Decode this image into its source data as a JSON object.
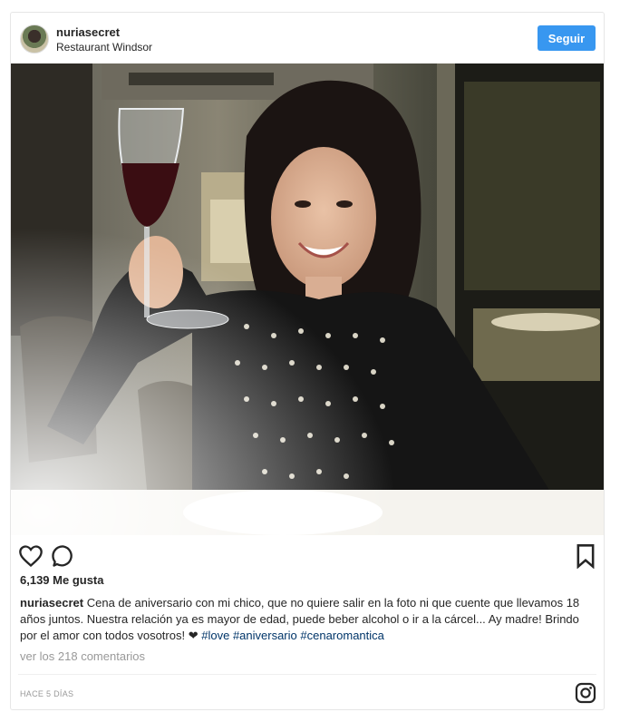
{
  "post": {
    "username": "nuriasecret",
    "location": "Restaurant Windsor",
    "follow_label": "Seguir",
    "likes": "6,139 Me gusta",
    "caption": {
      "username": "nuriasecret",
      "text": "Cena de aniversario con mi chico, que no quiere salir en la foto ni que cuente que llevamos 18 años juntos. Nuestra relación ya es mayor de edad, puede beber alcohol o ir a la cárcel... Ay madre! Brindo por el amor con todos vosotros! ",
      "heart": "❤",
      "hashtags": [
        "#love",
        "#aniversario",
        "#cenaromantica"
      ]
    },
    "view_comments": "ver los 218 comentarios",
    "timestamp": "HACE 5 DÍAS"
  },
  "icons": {
    "like": "heart-outline",
    "comment": "speech-bubble",
    "save": "bookmark",
    "brand": "instagram-logo"
  },
  "colors": {
    "follow_button": "#3897f0",
    "hashtag": "#003569",
    "muted_text": "#999999"
  }
}
